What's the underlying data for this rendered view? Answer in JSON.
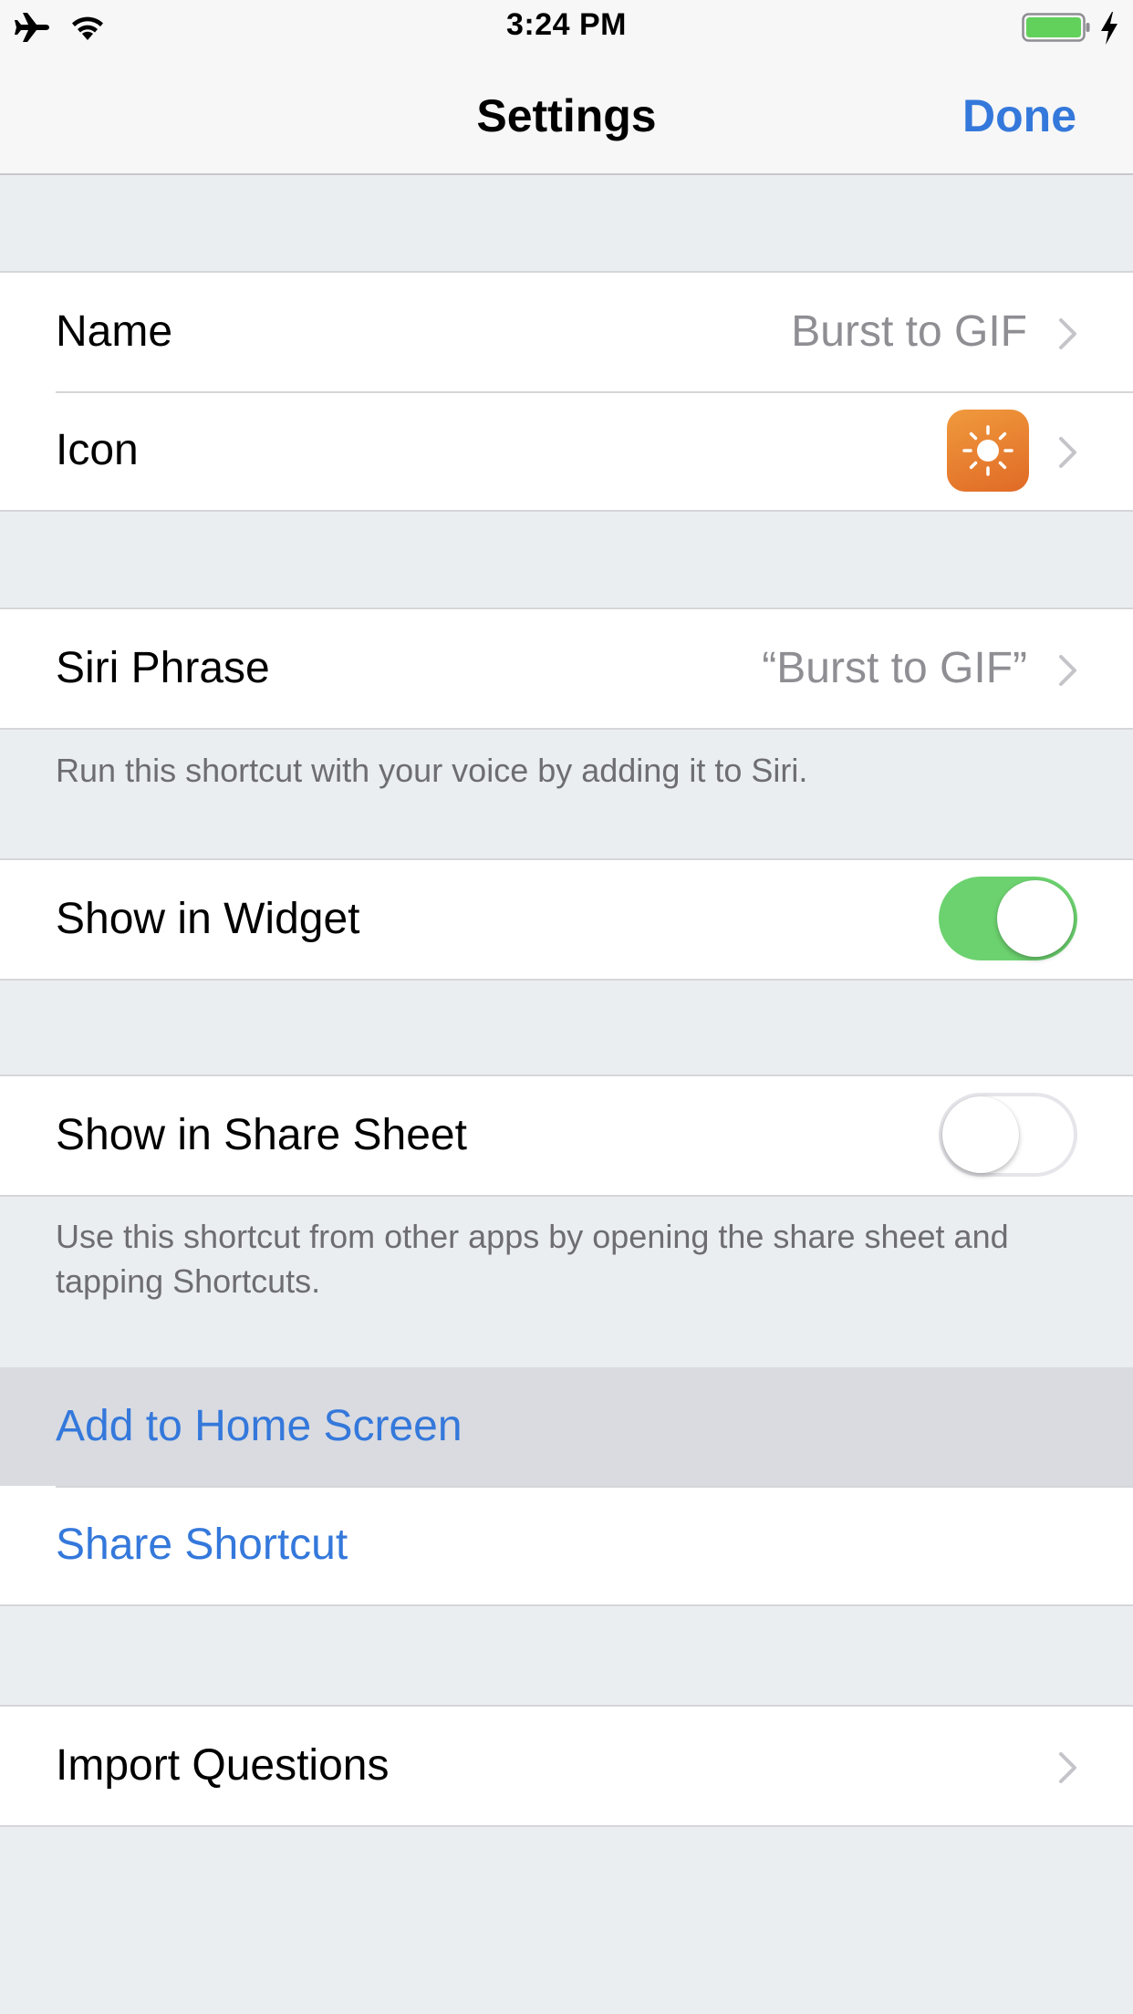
{
  "status_bar": {
    "time": "3:24 PM",
    "icons": [
      "airplane-icon",
      "wifi-icon",
      "battery-icon",
      "charging-bolt-icon"
    ],
    "battery_color": "#62d15b"
  },
  "nav": {
    "title": "Settings",
    "done_label": "Done"
  },
  "colors": {
    "accent": "#3478db",
    "toggle_on": "#6cd26f",
    "background": "#ebeef1",
    "icon_gradient": [
      "#f09a3d",
      "#e06a26"
    ]
  },
  "rows": {
    "name": {
      "label": "Name",
      "value": "Burst to GIF"
    },
    "icon": {
      "label": "Icon",
      "glyph": "sun-icon"
    },
    "siri": {
      "label": "Siri Phrase",
      "value": "“Burst to GIF”",
      "note": "Run this shortcut with your voice by adding it to Siri."
    },
    "widget": {
      "label": "Show in Widget",
      "enabled": true
    },
    "share_sheet": {
      "label": "Show in Share Sheet",
      "enabled": false,
      "note": "Use this shortcut from other apps by opening the share sheet and tapping Shortcuts."
    },
    "add_home": {
      "label": "Add to Home Screen"
    },
    "share_shortcut": {
      "label": "Share Shortcut"
    },
    "import_questions": {
      "label": "Import Questions"
    }
  }
}
